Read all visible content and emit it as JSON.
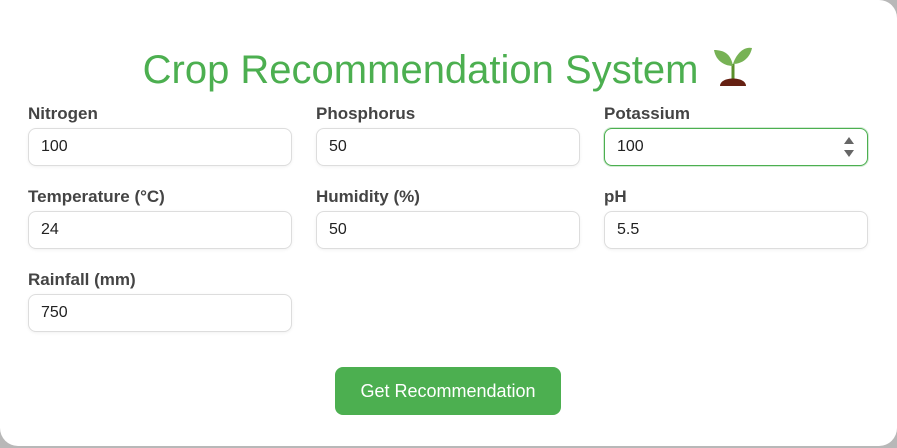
{
  "header": {
    "title": "Crop Recommendation System",
    "title_color": "#4caf50",
    "emoji_icon": "seedling-icon"
  },
  "form": {
    "fields": [
      {
        "label": "Nitrogen",
        "value": "100",
        "focused": false
      },
      {
        "label": "Phosphorus",
        "value": "50",
        "focused": false
      },
      {
        "label": "Potassium",
        "value": "100",
        "focused": true
      },
      {
        "label": "Temperature (°C)",
        "value": "24",
        "focused": false
      },
      {
        "label": "Humidity (%)",
        "value": "50",
        "focused": false
      },
      {
        "label": "pH",
        "value": "5.5",
        "focused": false
      },
      {
        "label": "Rainfall (mm)",
        "value": "750",
        "focused": false
      }
    ]
  },
  "actions": {
    "submit_label": "Get Recommendation",
    "accent_color": "#4caf50"
  }
}
